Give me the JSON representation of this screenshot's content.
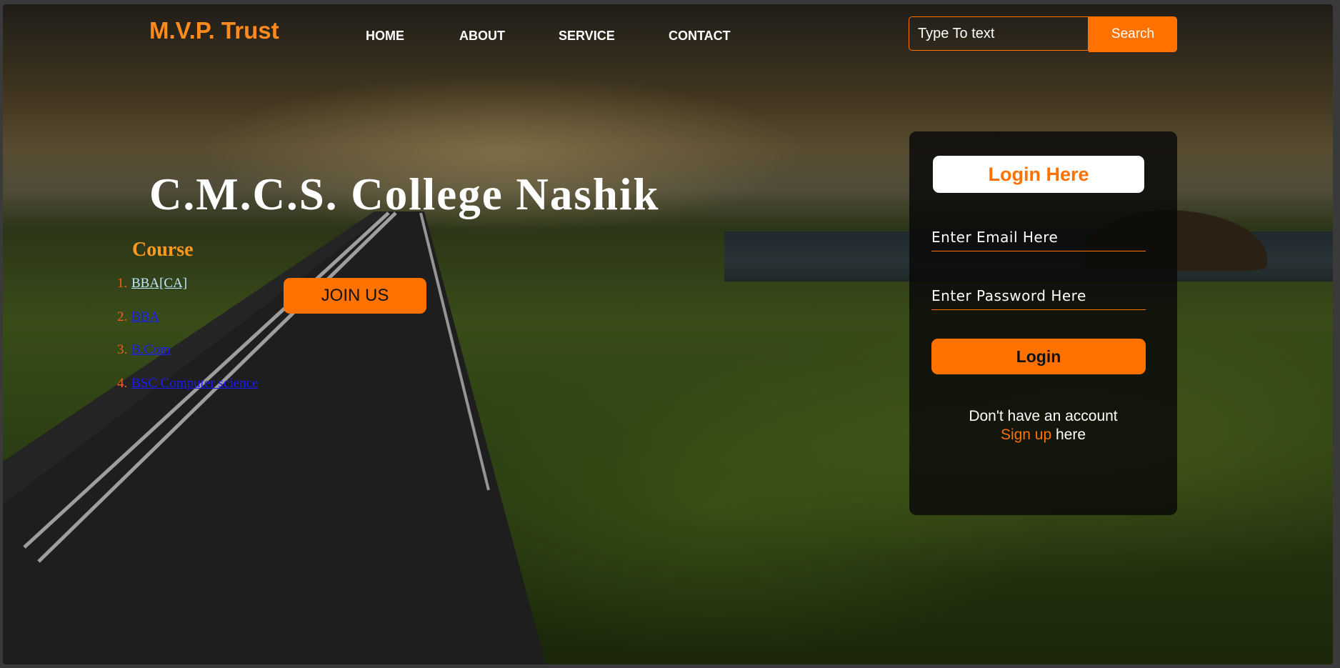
{
  "header": {
    "brand": "M.V.P. Trust",
    "nav": [
      {
        "label": "HOME"
      },
      {
        "label": "ABOUT"
      },
      {
        "label": "SERVICE"
      },
      {
        "label": "CONTACT"
      }
    ],
    "search": {
      "placeholder": "Type To text",
      "button_label": "Search"
    }
  },
  "hero": {
    "title": "C.M.C.S. College Nashik",
    "course_heading": "Course",
    "courses": [
      {
        "num": "1.",
        "label": "BBA[CA]"
      },
      {
        "num": "2.",
        "label": "BBA"
      },
      {
        "num": "3.",
        "label": "B.Com"
      },
      {
        "num": "4.",
        "label": "BSC Computer science"
      }
    ],
    "join_label": "JOIN US"
  },
  "login": {
    "heading": "Login Here",
    "email_placeholder": "Enter Email Here",
    "password_placeholder": "Enter Password Here",
    "button_label": "Login",
    "no_account_text": "Don't have an account",
    "signup_link": "Sign up",
    "signup_suffix": " here"
  },
  "colors": {
    "accent": "#ff7200",
    "brand": "#ff8a1d"
  }
}
